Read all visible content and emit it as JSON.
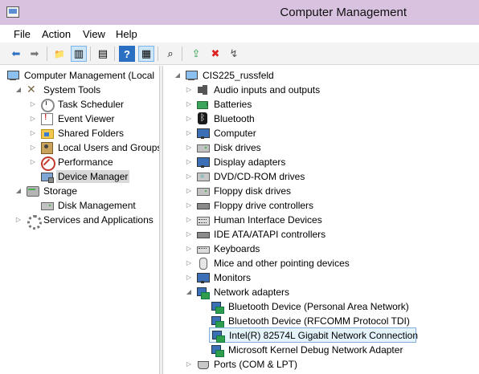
{
  "window": {
    "title": "Computer Management"
  },
  "menu": [
    "File",
    "Action",
    "View",
    "Help"
  ],
  "toolbar": {
    "buttons": [
      "back-icon",
      "forward-icon",
      "up-folder-icon",
      "show-hide-tree-icon",
      "export-icon",
      "help-icon",
      "show-hide-action-pane-icon",
      "scan-hardware-icon",
      "update-driver-icon",
      "uninstall-device-icon",
      "disable-device-icon"
    ],
    "glyphs": [
      "⬅",
      "➡",
      "📁",
      "▥",
      "▤",
      "?",
      "▦",
      "⌕",
      "⇪",
      "✖",
      "↯"
    ]
  },
  "left_tree": {
    "root": "Computer Management (Local",
    "system_tools": "System Tools",
    "task_scheduler": "Task Scheduler",
    "event_viewer": "Event Viewer",
    "shared_folders": "Shared Folders",
    "local_users": "Local Users and Groups",
    "performance": "Performance",
    "device_manager": "Device Manager",
    "storage": "Storage",
    "disk_management": "Disk Management",
    "services_apps": "Services and Applications"
  },
  "right_tree": {
    "root": "CIS225_russfeld",
    "audio": "Audio inputs and outputs",
    "batteries": "Batteries",
    "bluetooth": "Bluetooth",
    "computer": "Computer",
    "disk_drives": "Disk drives",
    "display": "Display adapters",
    "dvd": "DVD/CD-ROM drives",
    "floppy_disk": "Floppy disk drives",
    "floppy_ctrl": "Floppy drive controllers",
    "hid": "Human Interface Devices",
    "ide": "IDE ATA/ATAPI controllers",
    "keyboards": "Keyboards",
    "mice": "Mice and other pointing devices",
    "monitors": "Monitors",
    "network": "Network adapters",
    "net_bt_pan": "Bluetooth Device (Personal Area Network)",
    "net_bt_rfcomm": "Bluetooth Device (RFCOMM Protocol TDI)",
    "net_intel": "Intel(R) 82574L Gigabit Network Connection",
    "net_ms_kdnet": "Microsoft Kernel Debug Network Adapter",
    "ports": "Ports (COM & LPT)"
  },
  "colors": {
    "titlebar": "#d9c2e0",
    "selection_highlight": "#e5f3fb",
    "selection_border": "#84acdd"
  }
}
